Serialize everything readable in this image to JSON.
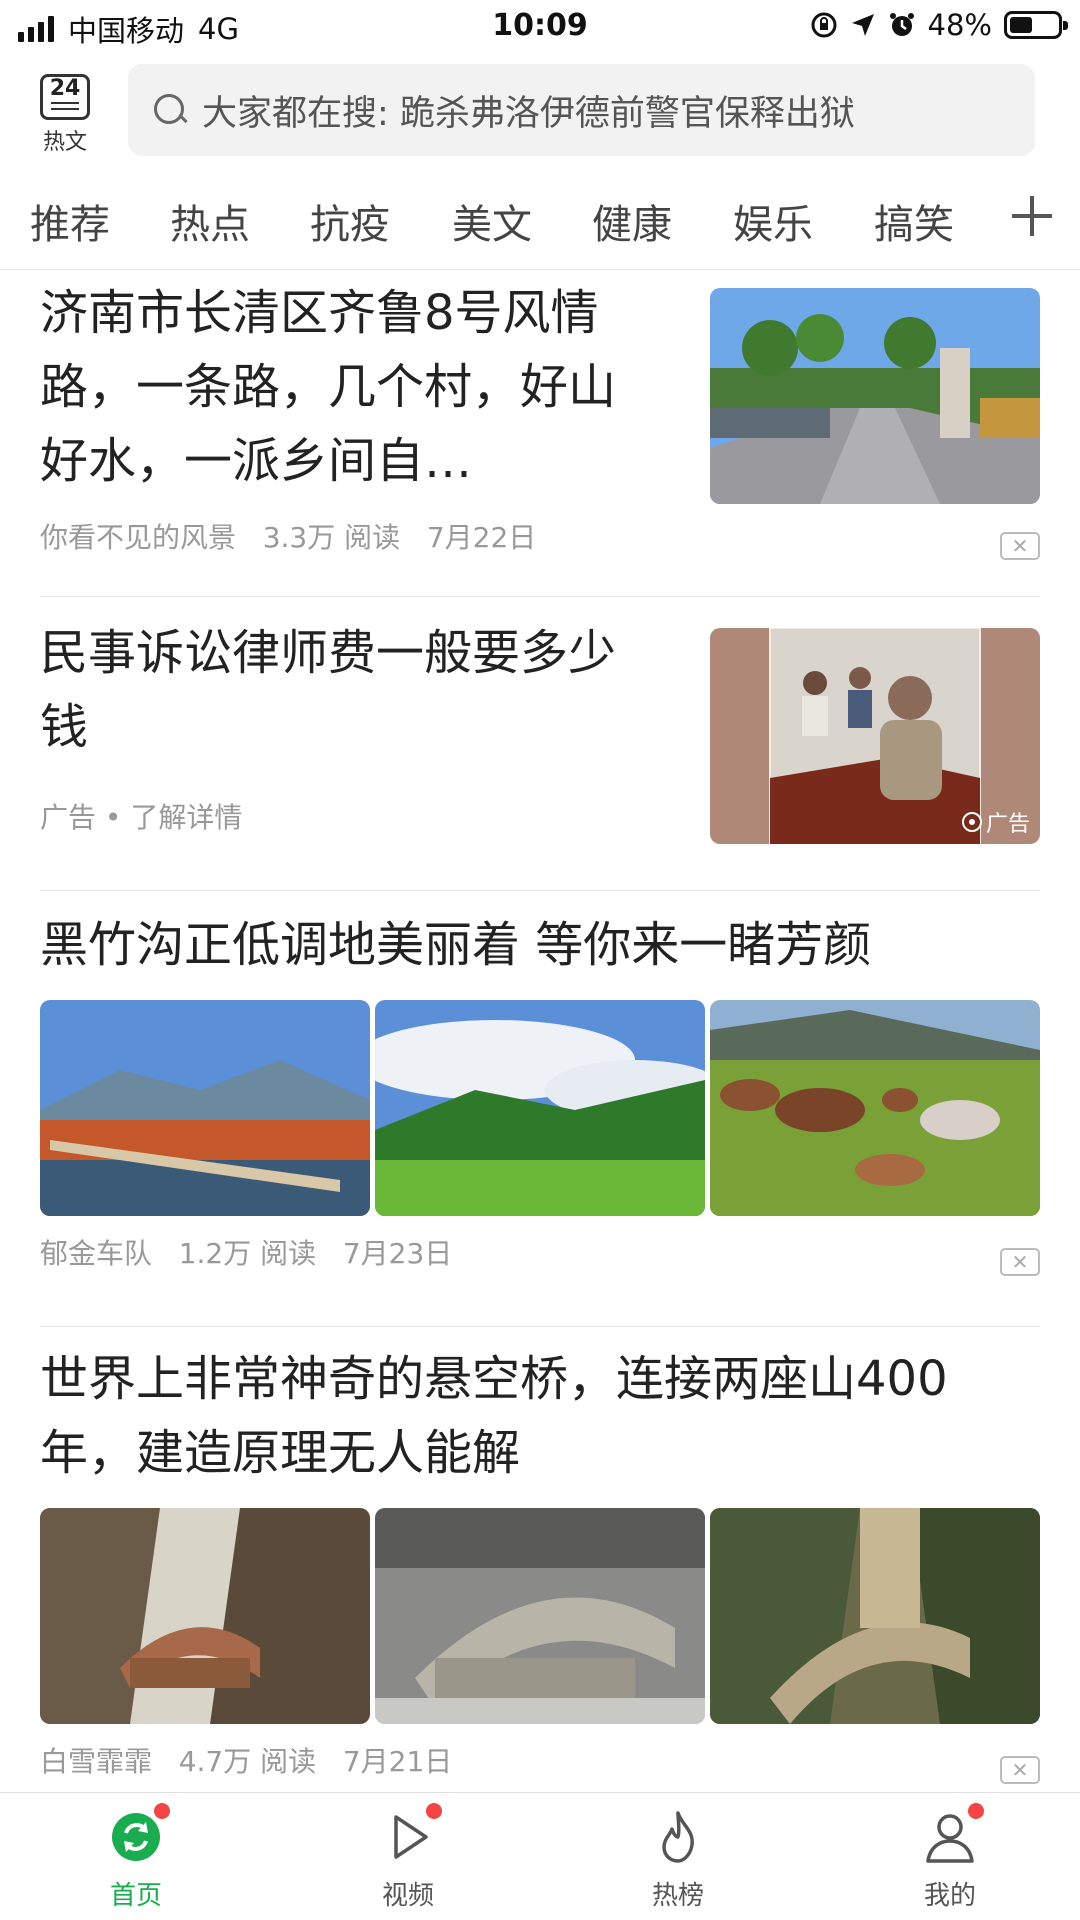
{
  "status_bar": {
    "carrier": "中国移动",
    "network": "4G",
    "time": "10:09",
    "battery": "48%",
    "battery_level": 0.48
  },
  "header": {
    "hot_logo_number": "24",
    "hot_logo_label": "热文",
    "search_placeholder": "大家都在搜: 跪杀弗洛伊德前警官保释出狱"
  },
  "tabs": [
    "推荐",
    "热点",
    "抗疫",
    "美文",
    "健康",
    "娱乐",
    "搞笑"
  ],
  "feed": [
    {
      "title": "济南市长清区齐鲁8号风情路，一条路，几个村，好山好水，一派乡间自…",
      "source": "你看不见的风景",
      "reads": "3.3万 阅读",
      "date": "7月22日"
    },
    {
      "title": "民事诉讼律师费一般要多少钱",
      "ad_meta": "广告 • 了解详情",
      "ad_label": "广告"
    },
    {
      "title": "黑竹沟正低调地美丽着 等你来一睹芳颜",
      "source": "郁金车队",
      "reads": "1.2万 阅读",
      "date": "7月23日"
    },
    {
      "title": "世界上非常神奇的悬空桥，连接两座山400年，建造原理无人能解",
      "source": "白雪霏霏",
      "reads": "4.7万 阅读",
      "date": "7月21日"
    }
  ],
  "bottom_nav": [
    {
      "label": "首页",
      "icon": "refresh-home-icon",
      "active": true
    },
    {
      "label": "视频",
      "icon": "play-icon",
      "active": false
    },
    {
      "label": "热榜",
      "icon": "flame-icon",
      "active": false
    },
    {
      "label": "我的",
      "icon": "person-icon",
      "active": false
    }
  ],
  "colors": {
    "accent_green": "#1aad50",
    "badge_red": "#f44444"
  }
}
